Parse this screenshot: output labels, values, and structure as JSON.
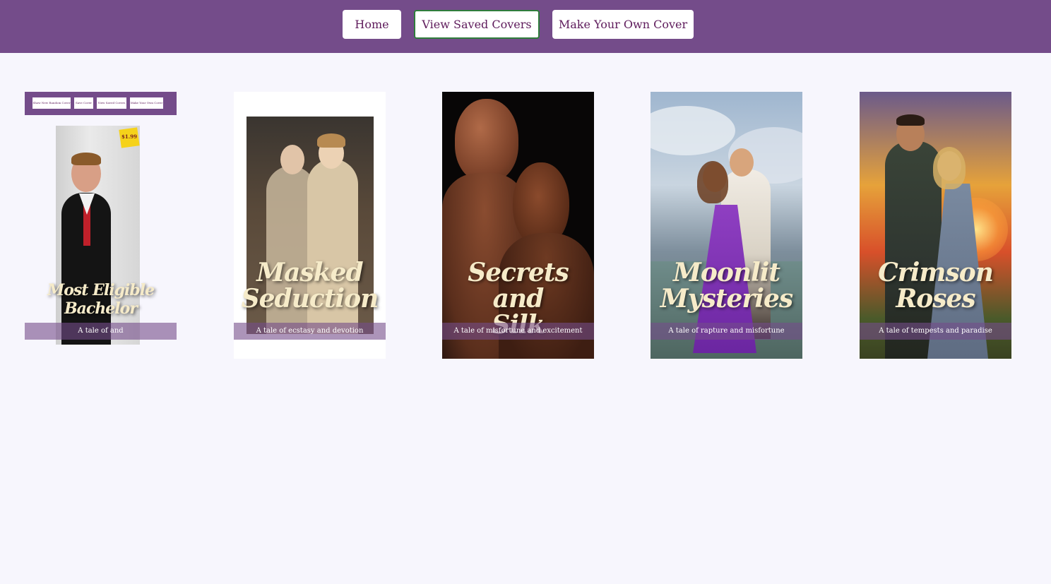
{
  "nav": {
    "home_label": "Home",
    "saved_label": "View Saved Covers",
    "make_label": "Make Your Own Cover"
  },
  "covers": [
    {
      "title_line1": "Most Eligible",
      "title_line2": "Bachelor",
      "tagline": "A tale of and",
      "mini_nav": [
        "Show New Random Cover",
        "Save Cover",
        "View Saved Covers",
        "Make Your Own Cover"
      ],
      "price_tag": "$1.99"
    },
    {
      "title_line1": "Masked",
      "title_line2": "Seduction",
      "tagline": "A tale of ecstasy and devotion"
    },
    {
      "title_line1": "Secrets and",
      "title_line2": "Silk",
      "tagline": "A tale of misfortune and excitement"
    },
    {
      "title_line1": "Moonlit",
      "title_line2": "Mysteries",
      "tagline": "A tale of rapture and misfortune"
    },
    {
      "title_line1": "Crimson",
      "title_line2": "Roses",
      "tagline": "A tale of tempests and paradise"
    }
  ],
  "colors": {
    "header": "#744c8a",
    "button_text": "#5e1b5b",
    "active_border": "#2f7d3c",
    "page_bg": "#f7f6fd",
    "title_text": "#f6ebc9"
  }
}
